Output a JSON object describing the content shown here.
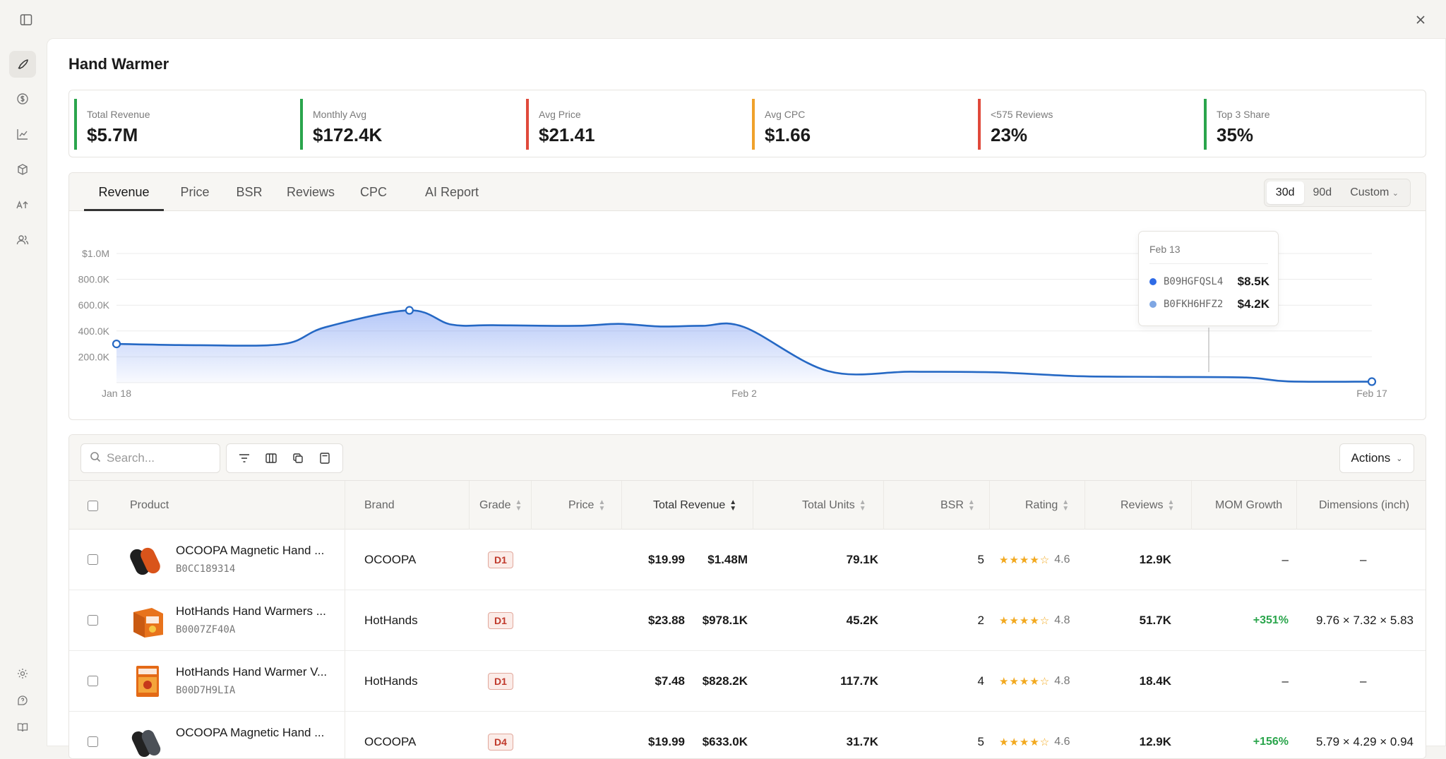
{
  "page_title": "Hand Warmer",
  "kpis": [
    {
      "label": "Total Revenue",
      "value": "$5.7M",
      "color": "#2aa54c"
    },
    {
      "label": "Monthly Avg",
      "value": "$172.4K",
      "color": "#2aa54c"
    },
    {
      "label": "Avg Price",
      "value": "$21.41",
      "color": "#e0493b"
    },
    {
      "label": "Avg CPC",
      "value": "$1.66",
      "color": "#f0a12b"
    },
    {
      "label": "<575 Reviews",
      "value": "23%",
      "color": "#e0493b"
    },
    {
      "label": "Top 3 Share",
      "value": "35%",
      "color": "#2aa54c"
    }
  ],
  "tabs": [
    "Revenue",
    "Price",
    "BSR",
    "Reviews",
    "CPC",
    "AI Report"
  ],
  "active_tab": "Revenue",
  "range": {
    "options": [
      "30d",
      "90d"
    ],
    "custom": "Custom",
    "selected": "30d"
  },
  "tooltip": {
    "date": "Feb 13",
    "rows": [
      {
        "code": "B09HGFQSL4",
        "amount": "$8.5K",
        "color": "#2f6be6"
      },
      {
        "code": "B0FKH6HFZ2",
        "amount": "$4.2K",
        "color": "#7ea6e3"
      }
    ]
  },
  "chart_data": {
    "type": "area",
    "x_ticks": [
      "Jan 18",
      "Feb 2",
      "Feb 17"
    ],
    "y_ticks": [
      "$1.0M",
      "800.0K",
      "600.0K",
      "400.0K",
      "200.0K"
    ],
    "ylim": [
      0,
      1000000
    ],
    "xlim": [
      "2025-01-18",
      "2025-02-17"
    ],
    "grid": true,
    "series": [
      {
        "color": "#2568c4",
        "x": [
          "2025-01-18",
          "2025-01-20",
          "2025-01-22",
          "2025-01-23",
          "2025-01-25",
          "2025-01-26",
          "2025-01-27",
          "2025-01-29",
          "2025-01-30",
          "2025-01-31",
          "2025-02-01",
          "2025-02-02",
          "2025-02-04",
          "2025-02-06",
          "2025-02-08",
          "2025-02-10",
          "2025-02-12",
          "2025-02-14",
          "2025-02-15",
          "2025-02-17"
        ],
        "values": [
          300000,
          290000,
          300000,
          430000,
          560000,
          450000,
          445000,
          440000,
          455000,
          435000,
          440000,
          430000,
          90000,
          85000,
          80000,
          50000,
          45000,
          40000,
          10000,
          8000
        ]
      }
    ]
  },
  "toolbar": {
    "search_placeholder": "Search...",
    "actions_label": "Actions"
  },
  "columns": {
    "product": "Product",
    "brand": "Brand",
    "grade": "Grade",
    "price": "Price",
    "revenue": "Total Revenue",
    "units": "Total Units",
    "bsr": "BSR",
    "rating": "Rating",
    "reviews": "Reviews",
    "mom": "MOM Growth",
    "dims": "Dimensions (inch)"
  },
  "rows": [
    {
      "name": "OCOOPA Magnetic Hand ...",
      "asin": "B0CC189314",
      "brand": "OCOOPA",
      "grade": "D1",
      "price": "$19.99",
      "revenue": "$1.48M",
      "units": "79.1K",
      "bsr": "5",
      "stars": "★★★★☆",
      "rating": "4.6",
      "reviews": "12.9K",
      "mom": "–",
      "dims": "–",
      "thumb": "ocoopa"
    },
    {
      "name": "HotHands Hand Warmers ...",
      "asin": "B0007ZF40A",
      "brand": "HotHands",
      "grade": "D1",
      "price": "$23.88",
      "revenue": "$978.1K",
      "units": "45.2K",
      "bsr": "2",
      "stars": "★★★★☆",
      "rating": "4.8",
      "reviews": "51.7K",
      "mom": "+351%",
      "dims": "9.76 × 7.32 × 5.83",
      "thumb": "hotbox"
    },
    {
      "name": "HotHands Hand Warmer V...",
      "asin": "B00D7H9LIA",
      "brand": "HotHands",
      "grade": "D1",
      "price": "$7.48",
      "revenue": "$828.2K",
      "units": "117.7K",
      "bsr": "4",
      "stars": "★★★★☆",
      "rating": "4.8",
      "reviews": "18.4K",
      "mom": "–",
      "dims": "–",
      "thumb": "hotpack"
    },
    {
      "name": "OCOOPA Magnetic Hand ...",
      "asin": "",
      "brand": "OCOOPA",
      "grade": "D4",
      "price": "$19.99",
      "revenue": "$633.0K",
      "units": "31.7K",
      "bsr": "5",
      "stars": "★★★★☆",
      "rating": "4.6",
      "reviews": "12.9K",
      "mom": "+156%",
      "dims": "5.79 × 4.29 × 0.94",
      "thumb": "ocoopa2"
    }
  ]
}
